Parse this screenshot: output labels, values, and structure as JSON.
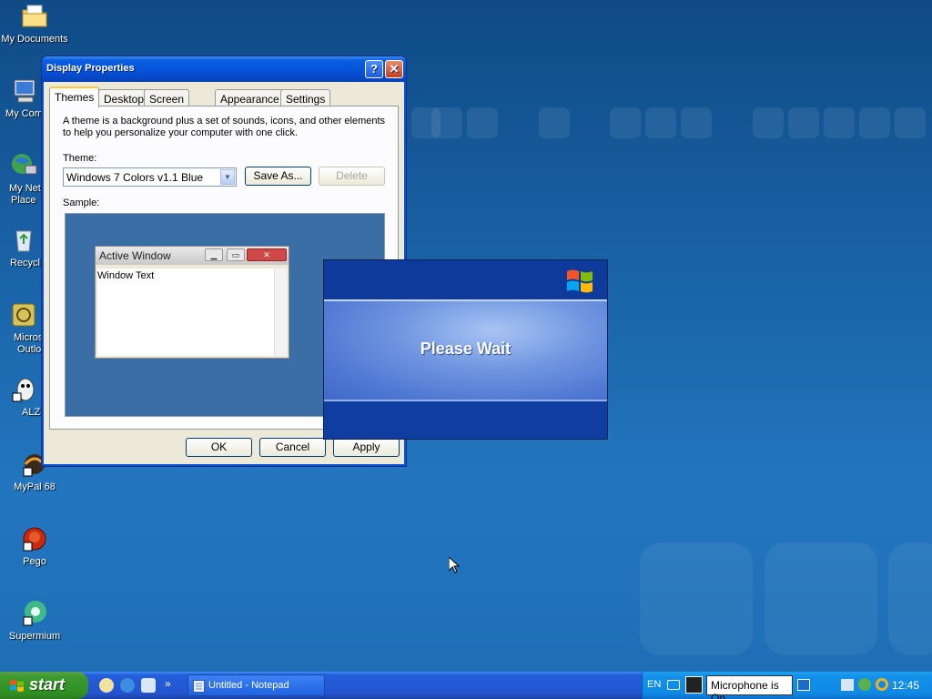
{
  "desktop": {
    "icons": [
      {
        "label": "My Documents"
      },
      {
        "label": "My Com"
      },
      {
        "label": "My Net"
      },
      {
        "label": "Place"
      },
      {
        "label": "Recycl"
      },
      {
        "label": "Micros"
      },
      {
        "label": "Outlo"
      },
      {
        "label": "ALZ"
      },
      {
        "label": "MyPal 68"
      },
      {
        "label": "Pego"
      },
      {
        "label": "Supermium"
      }
    ]
  },
  "dialog": {
    "title": "Display Properties",
    "help_glyph": "?",
    "close_glyph": "✕",
    "tabs": [
      "Themes",
      "Desktop",
      "Screen Saver",
      "Appearance",
      "Settings"
    ],
    "active_tab": "Themes",
    "description": "A theme is a background plus a set of sounds, icons, and other elements to help you personalize your computer with one click.",
    "theme_label": "Theme:",
    "theme_value": "Windows 7 Colors v1.1 Blue",
    "save_as_label": "Save As...",
    "delete_label": "Delete",
    "sample_label": "Sample:",
    "sample_window_title": "Active Window",
    "sample_window_text": "Window Text",
    "ok_label": "OK",
    "cancel_label": "Cancel",
    "apply_label": "Apply"
  },
  "wait_dialog": {
    "message": "Please Wait"
  },
  "taskbar": {
    "start_label": "start",
    "quicklaunch_more": "»",
    "tasks": [
      {
        "label": "Untitled - Notepad"
      }
    ],
    "language": "EN",
    "mic_tooltip": "Microphone is On",
    "clock": "12:45"
  },
  "colors": {
    "desktop_bg": "#1a64a8",
    "titlebar": "#0551d8",
    "taskbar": "#2454cf",
    "start_button": "#3c9b2e",
    "tray": "#1290e8"
  }
}
